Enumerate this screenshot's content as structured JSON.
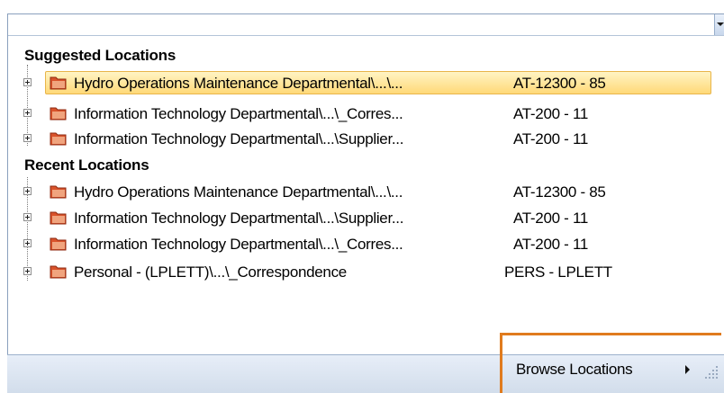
{
  "combo": {
    "value": ""
  },
  "groups": [
    {
      "header": "Suggested Locations",
      "items": [
        {
          "label": "Hydro Operations  Maintenance Departmental\\...\\...",
          "code": "AT-12300 - 85",
          "selected": true
        },
        {
          "label": "Information Technology Departmental\\...\\_Corres...",
          "code": "AT-200 - 11",
          "selected": false
        },
        {
          "label": "Information Technology Departmental\\...\\Supplier...",
          "code": "AT-200 - 11",
          "selected": false
        }
      ]
    },
    {
      "header": "Recent Locations",
      "items": [
        {
          "label": "Hydro Operations  Maintenance Departmental\\...\\...",
          "code": "AT-12300 - 85",
          "selected": false
        },
        {
          "label": "Information Technology Departmental\\...\\Supplier...",
          "code": "AT-200 - 11",
          "selected": false
        },
        {
          "label": "Information Technology Departmental\\...\\_Corres...",
          "code": "AT-200 - 11",
          "selected": false
        },
        {
          "label": "Personal - (LPLETT)\\...\\_Correspondence",
          "code": "PERS - LPLETT",
          "selected": false
        }
      ]
    }
  ],
  "footer": {
    "browse_label": "Browse Locations"
  },
  "icons": {
    "folder": "folder-icon",
    "expand": "expand-plus-icon",
    "submenu": "submenu-arrow-icon",
    "grip": "resize-grip-icon"
  },
  "colors": {
    "selection": "#ffd978",
    "highlight_box": "#e07b1e",
    "folder": "#d9532b"
  }
}
